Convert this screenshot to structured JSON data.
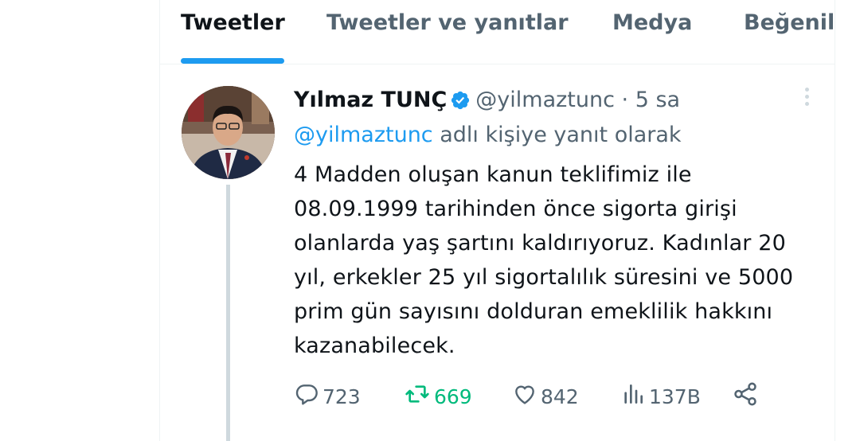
{
  "tabs": [
    {
      "label": "Tweetler",
      "active": true
    },
    {
      "label": "Tweetler ve yanıtlar",
      "active": false
    },
    {
      "label": "Medya",
      "active": false
    },
    {
      "label": "Beğenile",
      "active": false
    }
  ],
  "tweet": {
    "display_name": "Yılmaz TUNÇ",
    "handle": "@yilmaztunc",
    "separator": "·",
    "time": "5 sa",
    "reply_mention": "@yilmaztunc",
    "reply_suffix": "adlı kişiye yanıt olarak",
    "text_lines": [
      "4 Madden oluşan kanun teklifimiz ile",
      "08.09.1999 tarihinden önce sigorta girişi",
      "olanlarda yaş şartını kaldırıyoruz. Kadınlar 20",
      "yıl, erkekler 25 yıl sigortalılık süresini ve 5000",
      "prim gün sayısını dolduran emeklilik hakkını",
      "kazanabilecek."
    ],
    "stats": {
      "replies": "723",
      "retweets": "669",
      "likes": "842",
      "views": "137B"
    }
  },
  "icons": {
    "verified": "verified-badge-icon",
    "more": "more-options-icon",
    "reply": "reply-icon",
    "retweet": "retweet-icon",
    "like": "heart-icon",
    "views": "views-chart-icon",
    "share": "share-icon"
  },
  "colors": {
    "accent": "#1d9bf0",
    "secondary_text": "#536471",
    "retweet_active": "#00ba7c"
  }
}
